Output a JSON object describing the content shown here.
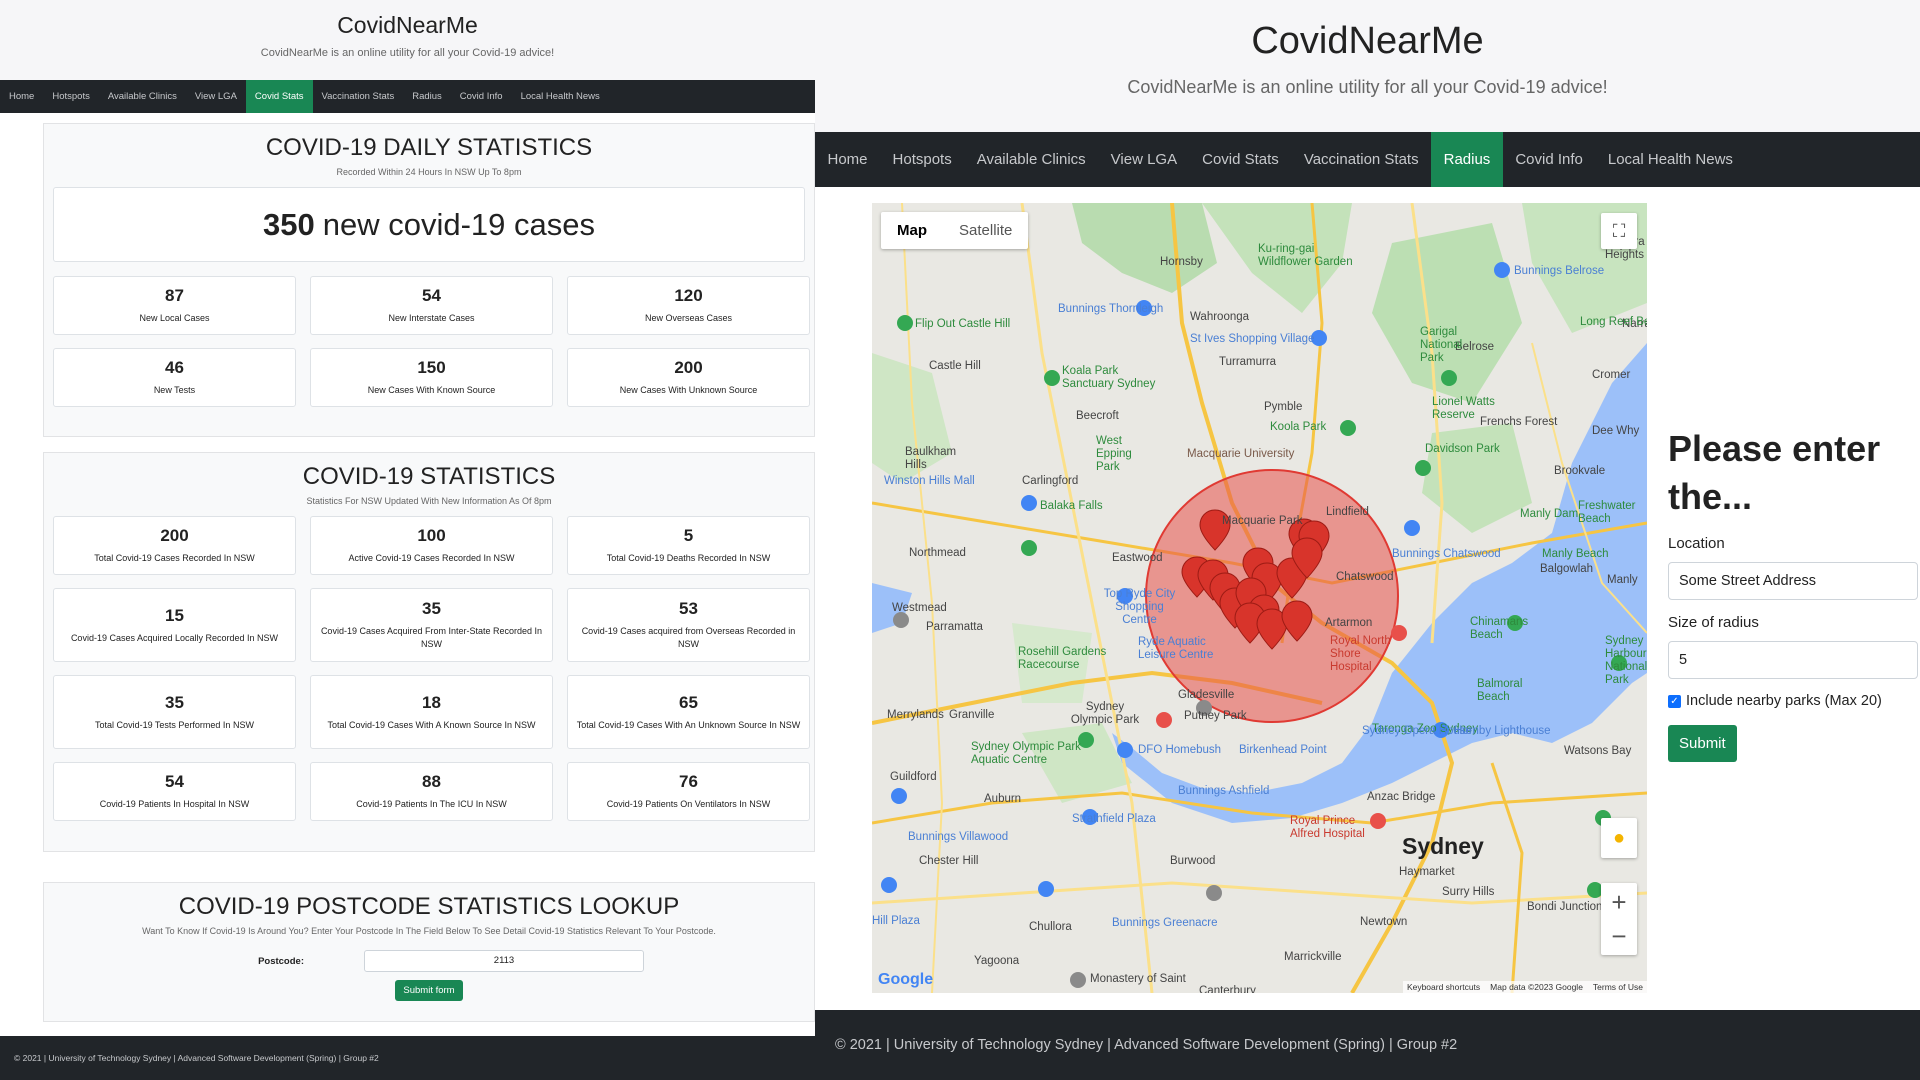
{
  "site": {
    "title": "CovidNearMe",
    "subtitle": "CovidNearMe is an online utility for all your Covid-19 advice!"
  },
  "nav": [
    "Home",
    "Hotspots",
    "Available Clinics",
    "View LGA",
    "Covid Stats",
    "Vaccination Stats",
    "Radius",
    "Covid Info",
    "Local Health News"
  ],
  "left_active_nav": "Covid Stats",
  "right_active_nav": "Radius",
  "daily": {
    "title": "COVID-19 DAILY STATISTICS",
    "subtitle": "Recorded Within 24 Hours In NSW Up To 8pm",
    "headline_number": "350",
    "headline_text": "new covid-19 cases",
    "cards": [
      {
        "value": "87",
        "label": "New Local Cases"
      },
      {
        "value": "54",
        "label": "New Interstate Cases"
      },
      {
        "value": "120",
        "label": "New Overseas Cases"
      },
      {
        "value": "46",
        "label": "New Tests"
      },
      {
        "value": "150",
        "label": "New Cases With Known Source"
      },
      {
        "value": "200",
        "label": "New Cases With Unknown Source"
      }
    ]
  },
  "stats": {
    "title": "COVID-19 STATISTICS",
    "subtitle": "Statistics For NSW Updated With New Information As Of 8pm",
    "cards": [
      {
        "value": "200",
        "label": "Total Covid-19 Cases Recorded In NSW"
      },
      {
        "value": "100",
        "label": "Active Covid-19 Cases Recorded In NSW"
      },
      {
        "value": "5",
        "label": "Total Covid-19 Deaths Recorded In NSW"
      },
      {
        "value": "15",
        "label": "Covid-19 Cases Acquired Locally Recorded In NSW"
      },
      {
        "value": "35",
        "label": "Covid-19 Cases Acquired From Inter-State Recorded In NSW"
      },
      {
        "value": "53",
        "label": "Covid-19 Cases acquired from Overseas Recorded in NSW"
      },
      {
        "value": "35",
        "label": "Total Covid-19 Tests Performed In NSW"
      },
      {
        "value": "18",
        "label": "Total Covid-19 Cases With A Known Source In NSW"
      },
      {
        "value": "65",
        "label": "Total Covid-19 Cases With An Unknown Source In NSW"
      },
      {
        "value": "54",
        "label": "Covid-19 Patients In Hospital In NSW"
      },
      {
        "value": "88",
        "label": "Covid-19 Patients In The ICU In NSW"
      },
      {
        "value": "76",
        "label": "Covid-19 Patients On Ventilators In NSW"
      }
    ]
  },
  "lookup": {
    "title": "COVID-19 POSTCODE STATISTICS LOOKUP",
    "subtitle": "Want To Know If Covid-19 Is Around You? Enter Your Postcode In The Field Below To See Detail Covid-19 Statistics Relevant To Your Postcode.",
    "postcode_label": "Postcode:",
    "postcode_value": "2113",
    "submit_label": "Submit form"
  },
  "footer": "© 2021 | University of Technology Sydney | Advanced Software Development (Spring) | Group #2",
  "map": {
    "type_map": "Map",
    "type_satellite": "Satellite",
    "zoom_in": "+",
    "zoom_out": "−",
    "attrib_shortcuts": "Keyboard shortcuts",
    "attrib_data": "Map data ©2023 Google",
    "attrib_terms": "Terms of Use",
    "logo": "Google",
    "places": [
      "Hornsby",
      "Wahroonga",
      "Turramurra",
      "Castle Hill",
      "Pymble",
      "Beecroft",
      "Baulkham Hills",
      "Carlingford",
      "Northmead",
      "Eastwood",
      "Lindfield",
      "Chatswood",
      "Westmead",
      "Parramatta",
      "Artarmon",
      "Merrylands",
      "Granville",
      "Gladesville",
      "Putney Park",
      "Sydney Olympic Park",
      "Auburn",
      "Guildford",
      "Burwood",
      "Chester Hill",
      "Yagoona",
      "Chullora",
      "Newtown",
      "Marrickville",
      "Sydney",
      "Haymarket",
      "Surry Hills",
      "Bondi Junction",
      "Manly",
      "Balgowlah",
      "Brookvale",
      "Dee Why",
      "Frenchs Forest",
      "Belrose",
      "Cromer",
      "Watsons Bay",
      "Elanora Heights",
      "Narra",
      "Canterbury",
      "Macquarie University",
      "Macquarie Park"
    ],
    "green_places": [
      "Flip Out Castle Hill",
      "Koala Park Sanctuary Sydney",
      "West Epping Park",
      "Balaka Falls",
      "Rosehill Gardens Racecourse",
      "Koola Park",
      "Lionel Watts Reserve",
      "Garigal National Park",
      "Davidson Park",
      "Freshwater Beach",
      "Manly Beach",
      "Manly Dam",
      "Chinamans Beach",
      "Balmoral Beach",
      "Taronga Zoo Sydney",
      "Sydney Harbour National Park",
      "Sydney Olympic Park Aquatic Centre",
      "Ku-ring-gai Wildflower Garden",
      "Long Reef Beach"
    ],
    "blue_places": [
      "Bunnings Thornleigh",
      "St Ives Shopping Village",
      "Winston Hills Mall",
      "Bunnings Belrose",
      "Bunnings Chatswood",
      "Top Ryde City Shopping Centre",
      "Ryde Aquatic Leisure Centre",
      "DFO Homebush",
      "Birkenhead Point",
      "Sydney Opera House",
      "Hornby Lighthouse",
      "Strathfield Plaza",
      "Bunnings Ashfield",
      "Bunnings Villawood",
      "Bunnings Greenacre",
      "Hill Plaza",
      "Anzac Bridge",
      "Monastery of Saint"
    ],
    "red_places": [
      "Royal North Shore Hospital",
      "Royal Prince Alfred Hospital"
    ],
    "radius_km": 5
  },
  "form": {
    "heading": "Please enter the...",
    "location_label": "Location",
    "location_value": "Some Street Address",
    "radius_label": "Size of radius",
    "radius_value": "5",
    "parks_label": "Include nearby parks (Max 20)",
    "parks_checked": true,
    "submit_label": "Submit"
  },
  "colors": {
    "brand_green": "#198754",
    "nav_dark": "#212529",
    "radius_fill": "#e8504a",
    "marker": "#d8342b"
  }
}
